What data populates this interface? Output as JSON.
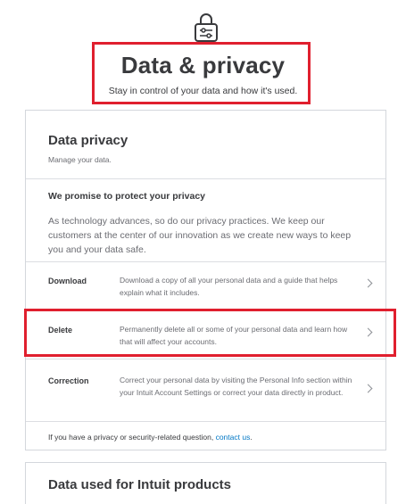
{
  "header": {
    "title": "Data & privacy",
    "subtitle": "Stay in control of your data and how it's used."
  },
  "privacy_card": {
    "title": "Data privacy",
    "subtitle": "Manage your data.",
    "promise_title": "We promise to protect your privacy",
    "promise_body": "As technology advances, so do our privacy practices. We keep our customers at the center of our innovation as we create new ways to keep you and your data safe.",
    "rows": [
      {
        "label": "Download",
        "description": "Download a copy of all your personal data and a guide that helps explain what it includes."
      },
      {
        "label": "Delete",
        "description": "Permanently delete all or some of your personal data and learn how that will affect your accounts."
      },
      {
        "label": "Correction",
        "description": "Correct your personal data by visiting the Personal Info section within your Intuit Account Settings or correct your data directly in product."
      }
    ],
    "footer_prefix": "If you have a privacy or security-related question, ",
    "footer_link": "contact us",
    "footer_suffix": "."
  },
  "products_card": {
    "title": "Data used for Intuit products"
  },
  "icons": {
    "header_icon": "lock-icon",
    "row_icon": "chevron-right-icon"
  },
  "colors": {
    "highlight": "#e01f2e",
    "link": "#0077c5",
    "text": "#393a3d",
    "muted": "#6b6c72"
  }
}
